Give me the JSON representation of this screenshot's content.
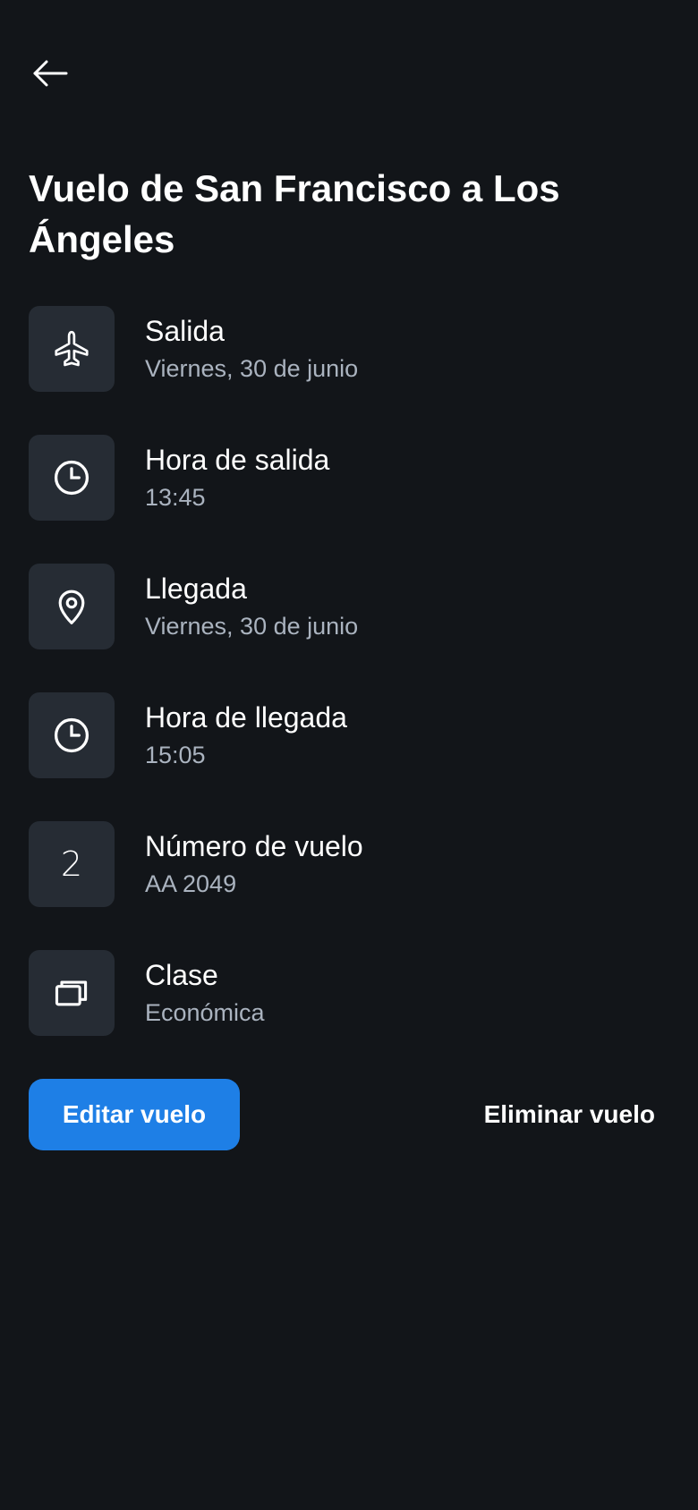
{
  "header": {
    "back_icon": "arrow-left-icon"
  },
  "title": "Vuelo de San Francisco a Los Ángeles",
  "details": [
    {
      "icon": "airplane-icon",
      "label": "Salida",
      "value": "Viernes, 30 de junio"
    },
    {
      "icon": "clock-icon",
      "label": "Hora de salida",
      "value": "13:45"
    },
    {
      "icon": "map-pin-icon",
      "label": "Llegada",
      "value": "Viernes, 30 de junio"
    },
    {
      "icon": "clock-icon",
      "label": "Hora de llegada",
      "value": "15:05"
    },
    {
      "icon": "number-icon",
      "glyph": "2",
      "label": "Número de vuelo",
      "value": "AA 2049"
    },
    {
      "icon": "seat-class-icon",
      "label": "Clase",
      "value": "Económica"
    }
  ],
  "actions": {
    "edit_label": "Editar vuelo",
    "delete_label": "Eliminar vuelo"
  },
  "colors": {
    "background": "#121519",
    "icon_tile": "#262c34",
    "primary": "#1e7fe6",
    "secondary_text": "#aab3bf"
  }
}
